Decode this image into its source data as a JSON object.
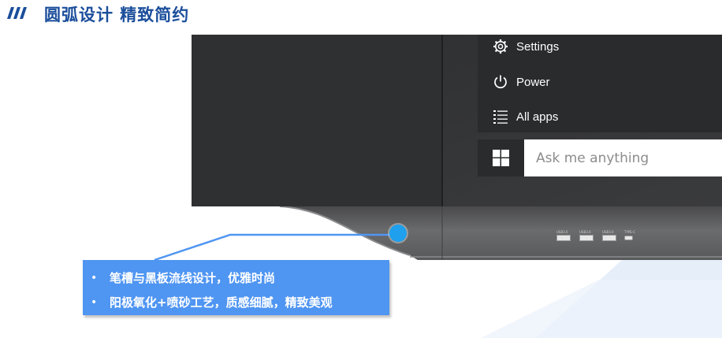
{
  "header": {
    "title": "圆弧设计 精致简约"
  },
  "start_menu": {
    "items": [
      {
        "icon": "gear-icon",
        "label": "Settings"
      },
      {
        "icon": "power-icon",
        "label": "Power"
      },
      {
        "icon": "all-apps-icon",
        "label": "All apps"
      }
    ],
    "search_placeholder": "Ask me anything"
  },
  "ports": [
    {
      "label": "USB3.0"
    },
    {
      "label": "USB3.0"
    },
    {
      "label": "USB3.0"
    },
    {
      "label": "TYPE-C"
    }
  ],
  "callout": {
    "bullet": "•",
    "lines": [
      "笔槽与黑板流线设计，优雅时尚",
      "阳极氧化+喷砂工艺，质感细腻，精致美观"
    ]
  },
  "colors": {
    "title": "#1b4e9b",
    "accent": "#4f95f2",
    "dot": "#1ea0ee"
  }
}
